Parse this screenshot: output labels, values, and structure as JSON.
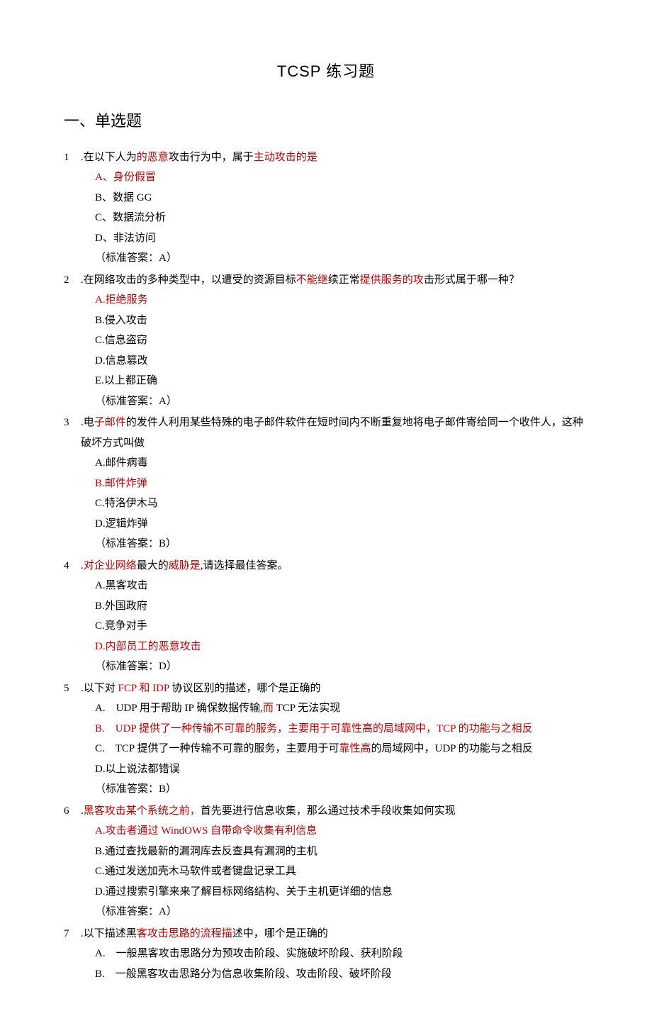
{
  "title": "TCSP 练习题",
  "section": "一、单选题",
  "questions": [
    {
      "num": "1",
      "stem_pre": ".在以下人为",
      "stem_red1": "的恶意",
      "stem_mid": "攻击行为中，属于",
      "stem_red2": "主动攻击的是",
      "stem_post": "",
      "opts": [
        {
          "label": "A、",
          "text": "身份假冒",
          "red": true
        },
        {
          "label": "B、",
          "text": "数据 GG",
          "red": false
        },
        {
          "label": "C、",
          "text": "数据流分析",
          "red": false
        },
        {
          "label": "D、",
          "text": "非法访问",
          "red": false
        }
      ],
      "answer": "（标准答案：A）"
    },
    {
      "num": "2",
      "stem_pre": ".在网络攻击的多种类型中，以遭受的资源目标",
      "stem_red1": "不能继",
      "stem_mid": "续正常",
      "stem_red2": "提供服务的攻",
      "stem_post": "击形式属于哪一种？",
      "opts": [
        {
          "label": "A.",
          "text": "拒绝服务",
          "red": true
        },
        {
          "label": "B.",
          "text": "侵入攻击",
          "red": false
        },
        {
          "label": "C.",
          "text": "信息盗窃",
          "red": false
        },
        {
          "label": "D.",
          "text": "信息篡改",
          "red": false
        },
        {
          "label": "E.",
          "text": "以上都正确",
          "red": false
        }
      ],
      "answer": "（标准答案：A）"
    },
    {
      "num": "3",
      "stem_pre": ".电",
      "stem_red1": "子邮件",
      "stem_mid": "的发件人利用某些特殊的电子邮件软件在短时间内不断重复地将电子邮件寄给同一个收件人，这种破坏方式叫做",
      "stem_red2": "",
      "stem_post": "",
      "opts": [
        {
          "label": "A.",
          "text": "邮件病毒",
          "red": false
        },
        {
          "label": "B.",
          "text": "邮件炸弹",
          "red": true
        },
        {
          "label": "C.",
          "text": "特洛伊木马",
          "red": false
        },
        {
          "label": "D.",
          "text": "逻辑炸弹",
          "red": false
        }
      ],
      "answer": "（标准答案：B）"
    },
    {
      "num": "4",
      "stem_pre": ".",
      "stem_red1": "对企业网络",
      "stem_mid": "最大的",
      "stem_red2": "威胁是",
      "stem_post": ",请选择最佳答案。",
      "opts": [
        {
          "label": "A.",
          "text": "黑客攻击",
          "red": false
        },
        {
          "label": "B.",
          "text": "外国政府",
          "red": false
        },
        {
          "label": "C.",
          "text": "竞争对手",
          "red": false
        },
        {
          "label": "D.",
          "text": "内部员工的恶意攻击",
          "red": true
        }
      ],
      "answer": "（标准答案：D）"
    },
    {
      "num": "5",
      "stem_pre": ".以下对",
      "stem_red1": " FCP 和 IDP ",
      "stem_mid": "协议区别的描述，哪个是正确的",
      "stem_red2": "",
      "stem_post": "",
      "opts": [
        {
          "label": "A.　",
          "text_pre": "UDP 用于帮助 IP 确保数据传输,",
          "text_red": "而",
          "text_post": " TCP 无法实现",
          "red": false,
          "compound": true
        },
        {
          "label": "B.　",
          "text": "UDP 提供了一种传输不可靠的服务，主要用于可靠性高的局域网中，TCP 的功能与之相反",
          "red": true
        },
        {
          "label": "C.　",
          "text_pre": "TCP 提供了一种传输不可靠的服务，主要用于可",
          "text_red": "靠性高",
          "text_post": "的局域网中，UDP 的功能与之相反",
          "red": false,
          "compound": true
        },
        {
          "label": "D.",
          "text": "以上说法都错误",
          "red": false
        }
      ],
      "answer": "（标准答案：B）"
    },
    {
      "num": "6",
      "stem_pre": ".",
      "stem_red1": "黑客攻击某个系统之前，",
      "stem_mid": "首先要进行信息收集，那么通过技术手段收集如何实现",
      "stem_red2": "",
      "stem_post": "",
      "opts": [
        {
          "label": "A.",
          "text": "攻击者通过 WindOWS 自带命令收集有利信息",
          "red": true
        },
        {
          "label": "B.",
          "text": "通过查找最新的漏洞库去反查具有漏洞的主机",
          "red": false
        },
        {
          "label": "C.",
          "text": "通过发送加壳木马软件或者键盘记录工具",
          "red": false
        },
        {
          "label": "D.",
          "text": "通过搜索引擎来来了解目标网络结构、关于主机更详细的信息",
          "red": false
        }
      ],
      "answer": "（标准答案：A）"
    },
    {
      "num": "7",
      "stem_pre": ".以下描述黑",
      "stem_red1": "客攻击思路的流程描",
      "stem_mid": "述中，哪个是正确的",
      "stem_red2": "",
      "stem_post": "",
      "opts": [
        {
          "label": "A.　",
          "text": "一般黑客攻击思路分为预攻击阶段、实施破坏阶段、获利阶段",
          "red": false
        },
        {
          "label": "B.　",
          "text": "一般黑客攻击思路分为信息收集阶段、攻击阶段、破坏阶段",
          "red": false
        }
      ],
      "answer": ""
    }
  ]
}
